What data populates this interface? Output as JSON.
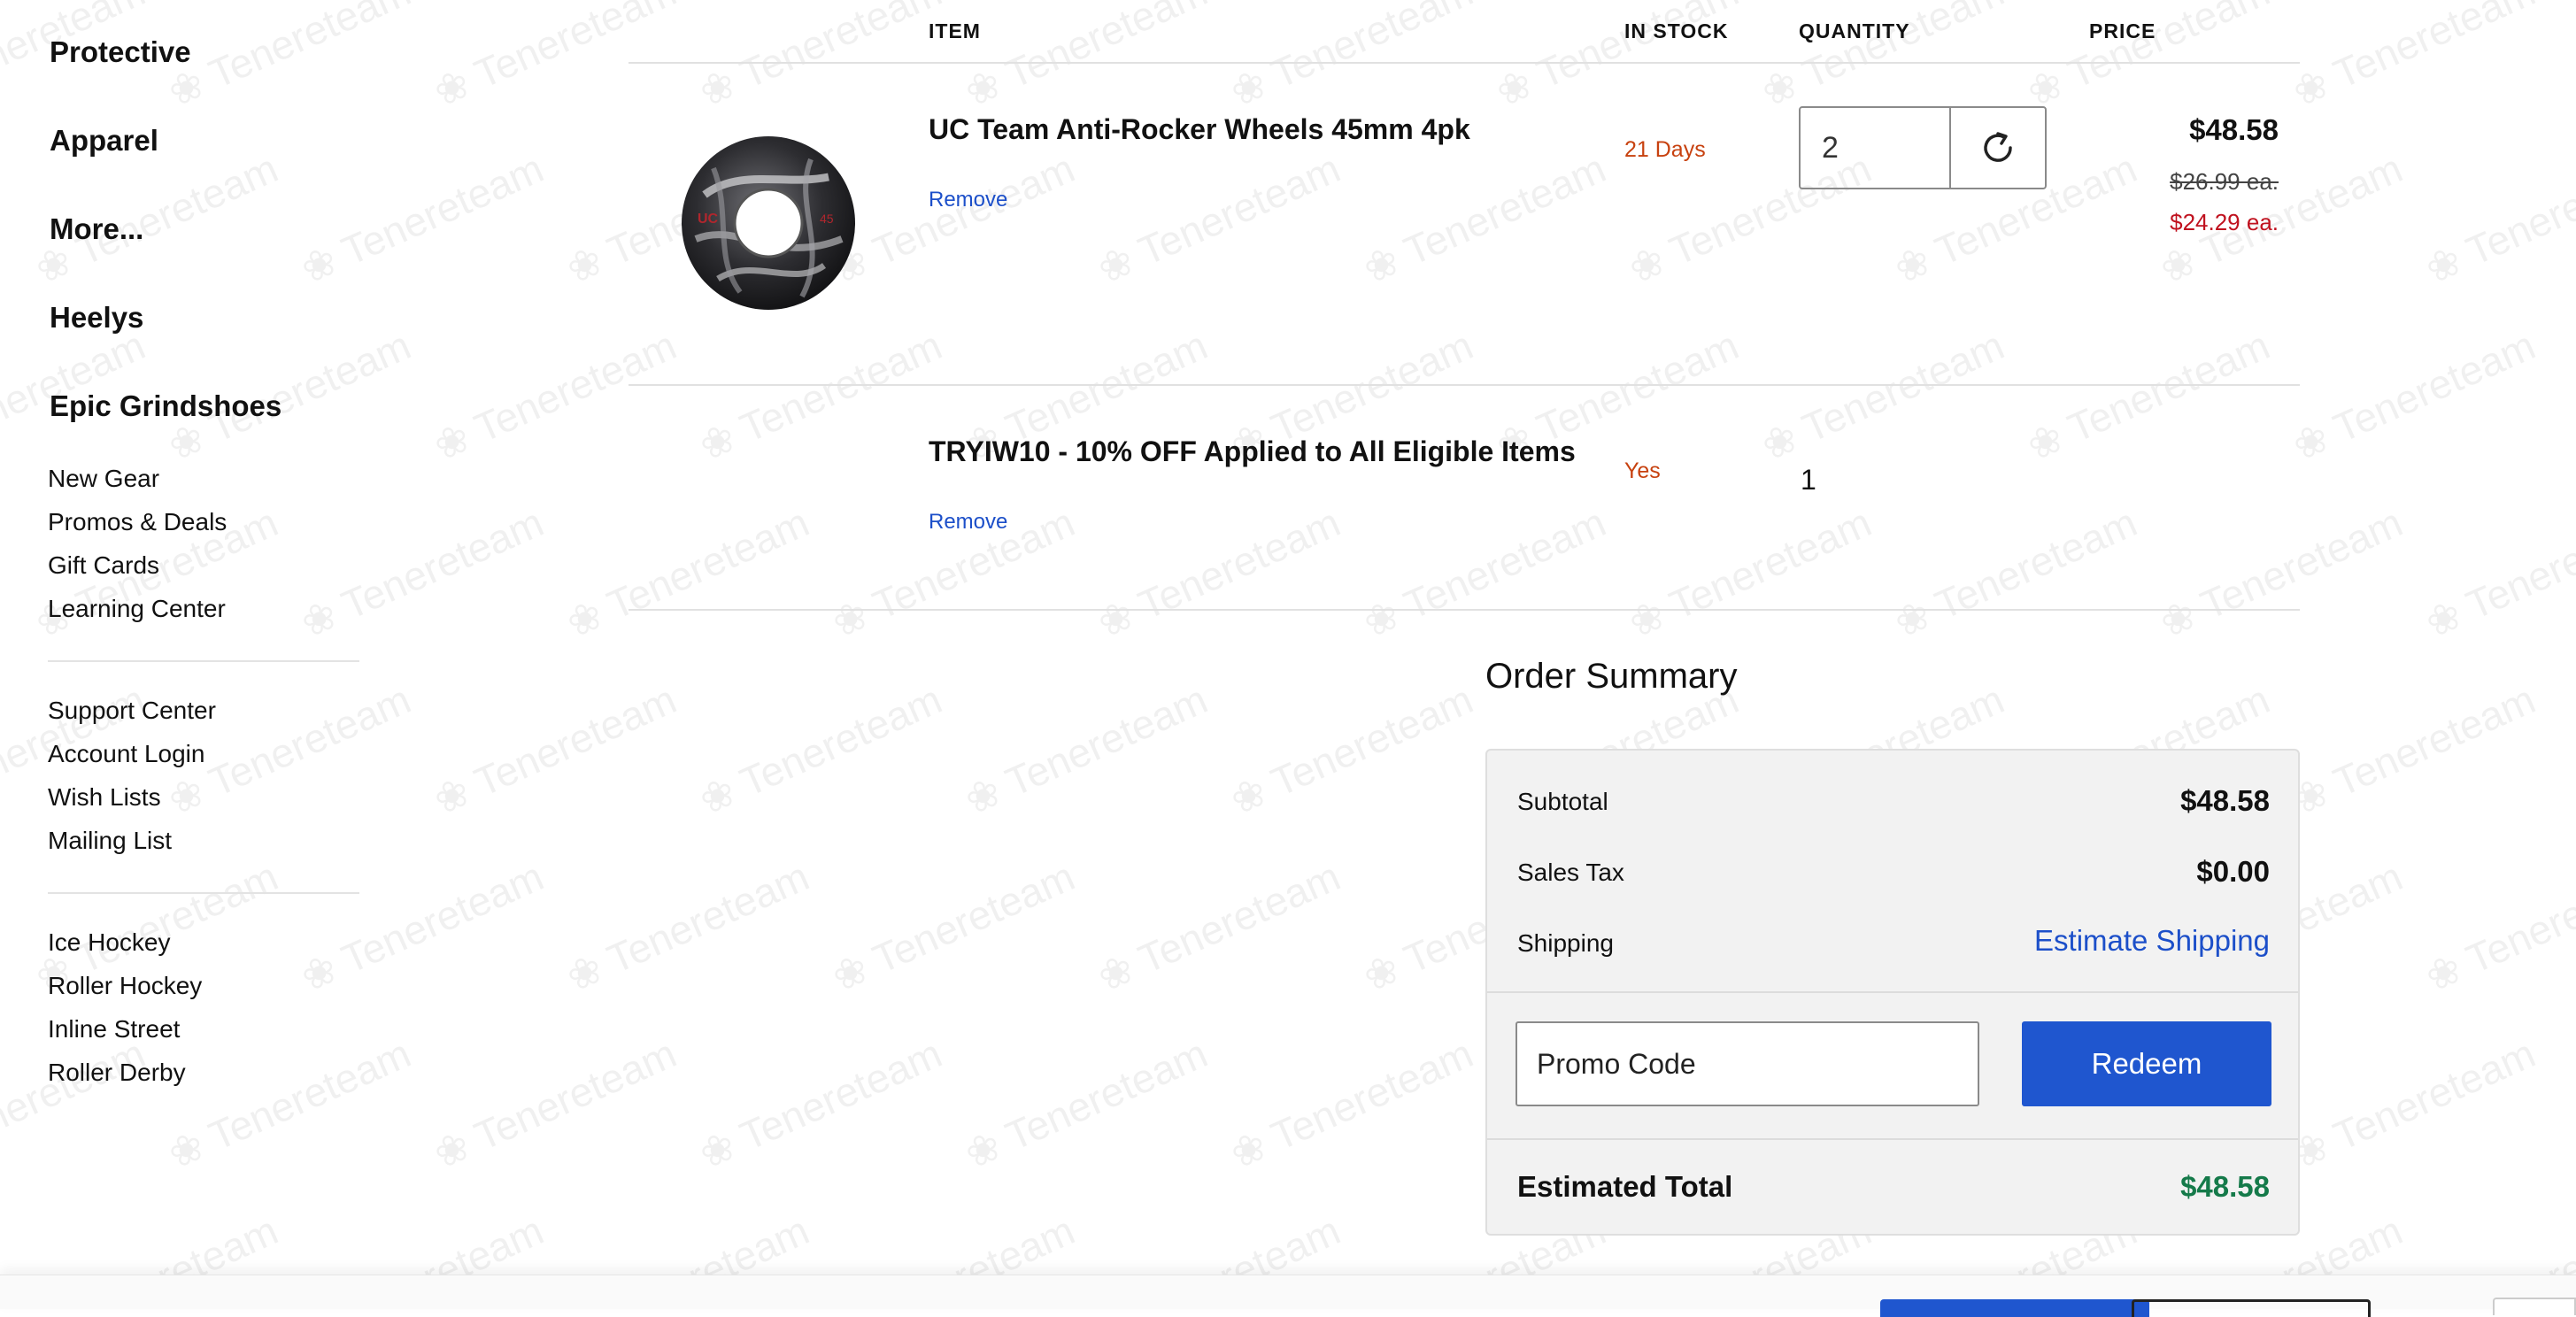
{
  "sidebar": {
    "major_items": [
      "Protective",
      "Apparel",
      "More...",
      "Heelys",
      "Epic Grindshoes"
    ],
    "group1": [
      "New Gear",
      "Promos & Deals",
      "Gift Cards",
      "Learning Center"
    ],
    "group2": [
      "Support Center",
      "Account Login",
      "Wish Lists",
      "Mailing List"
    ],
    "group3": [
      "Ice Hockey",
      "Roller Hockey",
      "Inline Street",
      "Roller Derby"
    ]
  },
  "cart": {
    "headers": {
      "item": "ITEM",
      "in_stock": "IN STOCK",
      "quantity": "QUANTITY",
      "price": "PRICE"
    },
    "items": [
      {
        "title": "UC Team Anti-Rocker Wheels 45mm 4pk",
        "remove": "Remove",
        "stock": "21 Days",
        "quantity": "2",
        "price": "$48.58",
        "original_each": "$26.99 ea.",
        "sale_each": "$24.29 ea."
      },
      {
        "title": "TRYIW10 - 10% OFF Applied to All Eligible Items",
        "remove": "Remove",
        "stock": "Yes",
        "quantity": "1"
      }
    ]
  },
  "summary": {
    "title": "Order Summary",
    "subtotal_label": "Subtotal",
    "subtotal_value": "$48.58",
    "tax_label": "Sales Tax",
    "tax_value": "$0.00",
    "shipping_label": "Shipping",
    "shipping_link": "Estimate Shipping",
    "promo_placeholder": "Promo Code",
    "redeem_label": "Redeem",
    "total_label": "Estimated Total",
    "total_value": "$48.58"
  },
  "watermark": "Tenereteam",
  "colors": {
    "accent_blue": "#1f56cf",
    "link_blue": "#1c4fc9",
    "stock_orange": "#c7410f",
    "sale_red": "#c0121f",
    "total_green": "#157a4a"
  },
  "icons": {
    "quantity_refresh": "refresh-icon",
    "product_image": "wheel-image"
  }
}
